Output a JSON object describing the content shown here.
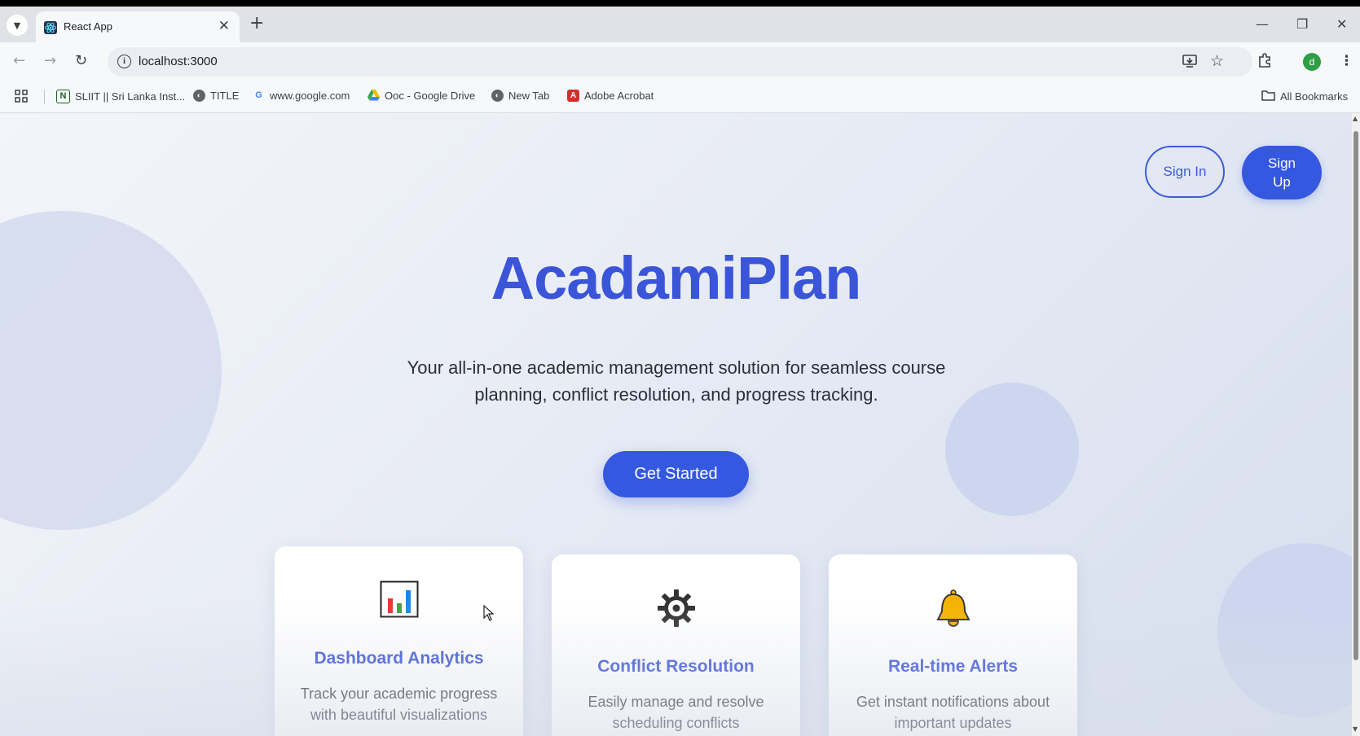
{
  "browser": {
    "tab_title": "React App",
    "new_tab": "+",
    "tab_close": "✕",
    "url": "localhost:3000",
    "window": {
      "minimize": "—",
      "restore": "❐",
      "close": "✕"
    },
    "profile_initial": "d",
    "bookmarks": [
      {
        "label": "SLIIT || Sri Lanka Inst...",
        "icon": "N"
      },
      {
        "label": "TITLE",
        "icon": "globe"
      },
      {
        "label": "www.google.com",
        "icon": "G"
      },
      {
        "label": "Ooc - Google Drive",
        "icon": "drive"
      },
      {
        "label": "New Tab",
        "icon": "globe"
      },
      {
        "label": "Adobe Acrobat",
        "icon": "acrobat"
      }
    ],
    "all_bookmarks": "All Bookmarks"
  },
  "nav": {
    "sign_in": "Sign In",
    "sign_up": "Sign Up"
  },
  "hero": {
    "title": "AcadamiPlan",
    "subtitle": "Your all-in-one academic management solution for seamless course planning, conflict resolution, and progress tracking.",
    "cta": "Get Started"
  },
  "features": [
    {
      "icon": "bar-chart-icon",
      "title": "Dashboard Analytics",
      "description": "Track your academic progress with beautiful visualizations"
    },
    {
      "icon": "gear-icon",
      "title": "Conflict Resolution",
      "description": "Easily manage and resolve scheduling conflicts"
    },
    {
      "icon": "bell-icon",
      "title": "Real-time Alerts",
      "description": "Get instant notifications about important updates"
    }
  ],
  "colors": {
    "accent": "#3558e0",
    "title": "#3b55d9"
  }
}
